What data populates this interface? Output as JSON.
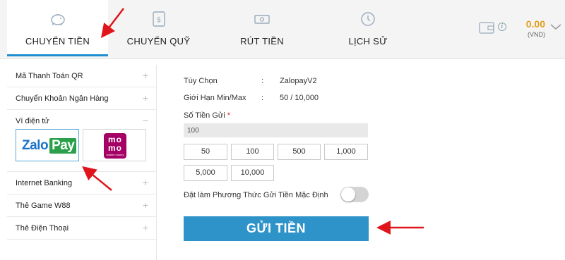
{
  "colors": {
    "accent": "#1e8fd0",
    "button": "#2e93c8",
    "balance": "#e0a020",
    "arrow": "#e0151b"
  },
  "tabs": [
    {
      "label": "CHUYỂN TIỀN",
      "icon": "piggy-bank-icon",
      "active": true
    },
    {
      "label": "CHUYỂN QUỸ",
      "icon": "transfer-icon",
      "active": false
    },
    {
      "label": "RÚT TIỀN",
      "icon": "cash-icon",
      "active": false
    },
    {
      "label": "LỊCH SỬ",
      "icon": "clock-icon",
      "active": false
    }
  ],
  "wallet": {
    "balance": "0.00",
    "currency": "(VND)",
    "icon": "wallet-icon"
  },
  "sidebar": {
    "items": [
      {
        "label": "Mã Thanh Toán QR",
        "toggle": "+"
      },
      {
        "label": "Chuyển Khoản Ngân Hàng",
        "toggle": "+"
      },
      {
        "label": "Ví điện tử",
        "toggle": "−"
      },
      {
        "label": "Internet Banking",
        "toggle": "+"
      },
      {
        "label": "Thẻ Game W88",
        "toggle": "+"
      },
      {
        "label": "Thẻ Điện Thoại",
        "toggle": "+"
      }
    ],
    "ewallets": {
      "zalopay": {
        "zalo": "Zalo",
        "pay": "Pay"
      },
      "momo": {
        "line1": "mo",
        "line2": "mo",
        "tagline": "mobile money"
      }
    }
  },
  "form": {
    "option_label": "Tùy Chọn",
    "option_sep": ":",
    "option_value": "ZalopayV2",
    "limit_label": "Giới Hạn Min/Max",
    "limit_sep": ":",
    "limit_value": "50 / 10,000",
    "amount_label": "Số Tiền Gửi",
    "required_mark": "*",
    "amount_value": "100",
    "quick_amounts": [
      "50",
      "100",
      "500",
      "1,000",
      "5,000",
      "10,000"
    ],
    "default_label": "Đặt làm Phương Thức Gửi Tiền Mặc Định",
    "default_enabled": false,
    "submit_label": "GỬI TIỀN"
  }
}
